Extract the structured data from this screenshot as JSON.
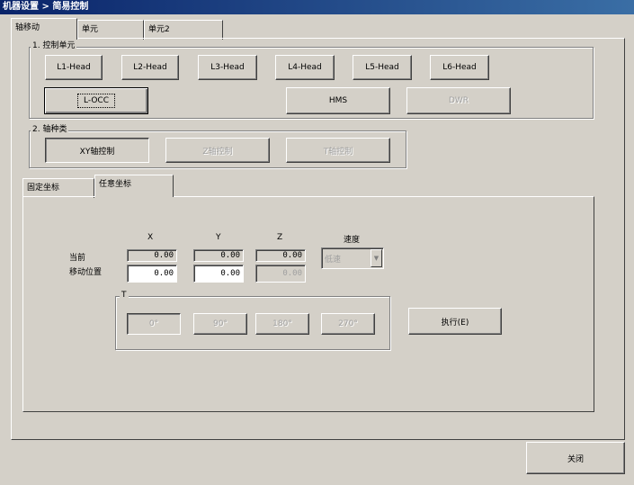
{
  "window": {
    "title": "机器设置 > 简易控制"
  },
  "main_tabs": [
    "轴移动",
    "单元",
    "单元2"
  ],
  "group1": {
    "legend": "1. 控制单元",
    "heads": [
      "L1-Head",
      "L2-Head",
      "L3-Head",
      "L4-Head",
      "L5-Head",
      "L6-Head"
    ],
    "occ_label": "L-OCC",
    "hms_label": "HMS",
    "dwr_label": "DWR"
  },
  "group2": {
    "legend": "2. 轴种类",
    "axes": [
      "XY轴控制",
      "Z轴控制",
      "T轴控制"
    ]
  },
  "sub_tabs": [
    "固定坐标",
    "任意坐标"
  ],
  "coords": {
    "col_x": "X",
    "col_y": "Y",
    "col_z": "Z",
    "col_speed": "速度",
    "row_current": "当前",
    "row_move": "移动位置",
    "current": {
      "x": "0.00",
      "y": "0.00",
      "z": "0.00"
    },
    "target": {
      "x": "0.00",
      "y": "0.00",
      "z": "0.00"
    },
    "speed_value": "低速"
  },
  "theta": {
    "legend": "T",
    "angles": [
      "0°",
      "90°",
      "180°",
      "270°"
    ]
  },
  "execute_label": "执行(E)",
  "close_label": "关闭"
}
